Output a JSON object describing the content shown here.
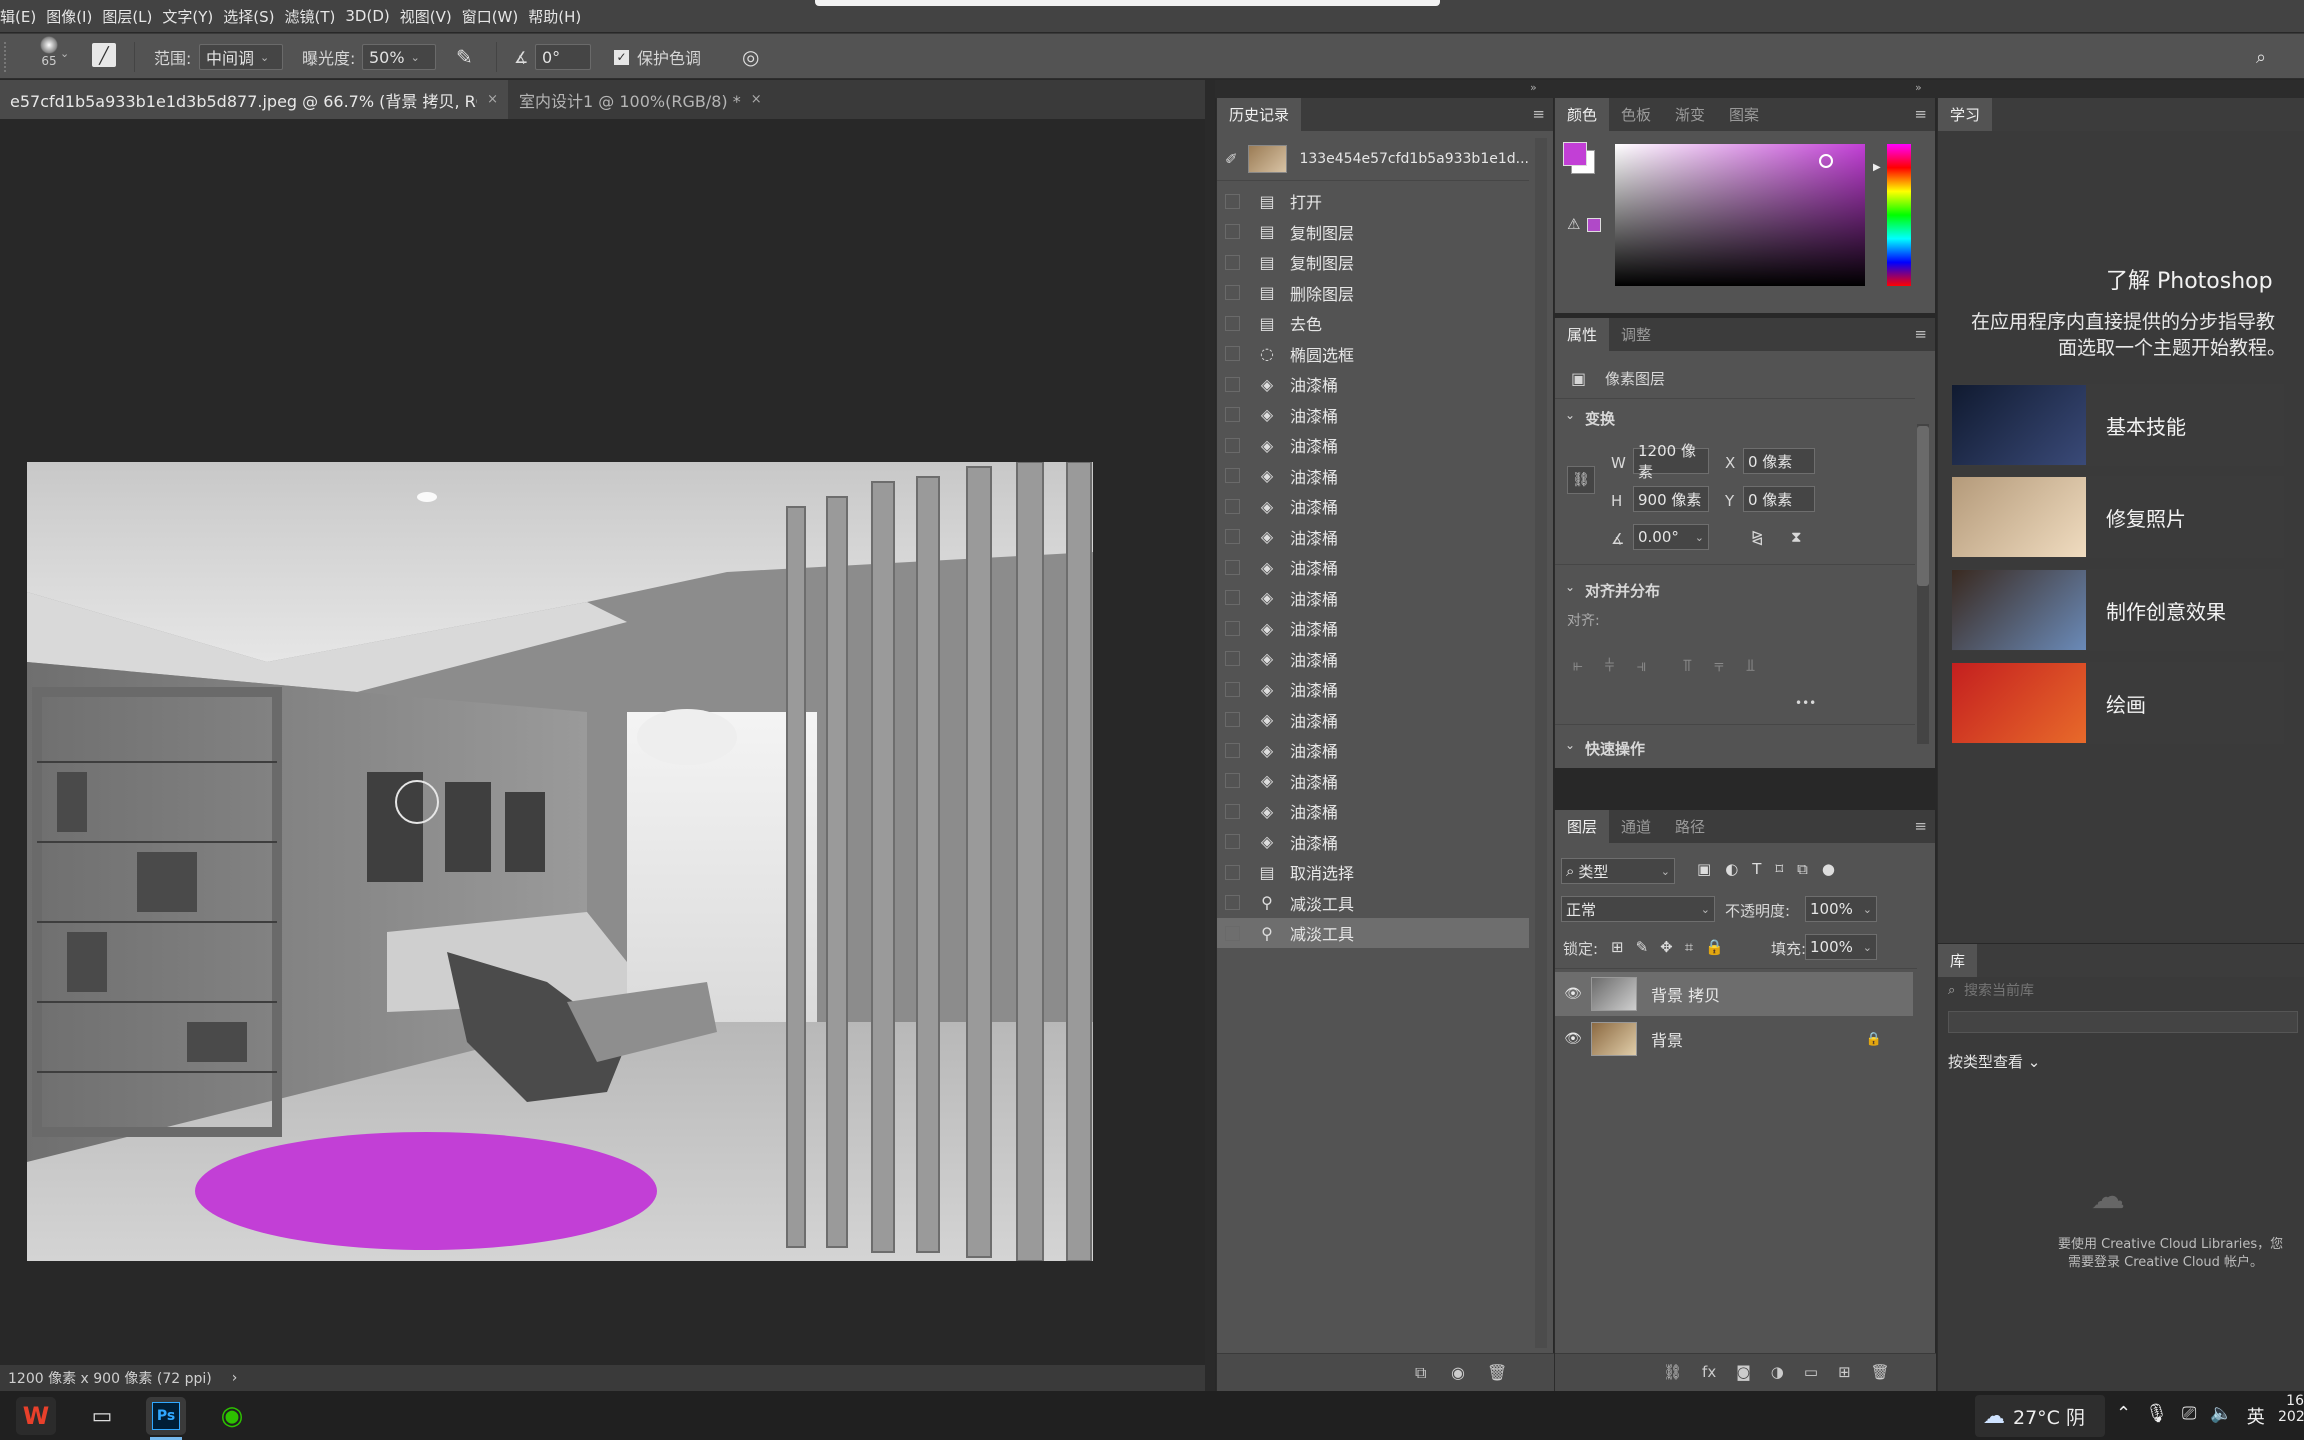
{
  "menu": [
    "辑(E)",
    "图像(I)",
    "图层(L)",
    "文字(Y)",
    "选择(S)",
    "滤镜(T)",
    "3D(D)",
    "视图(V)",
    "窗口(W)",
    "帮助(H)"
  ],
  "options": {
    "brush_size": "65",
    "range_label": "范围:",
    "range_value": "中间调",
    "exposure_label": "曝光度:",
    "exposure_value": "50%",
    "angle_value": "0°",
    "protect_tone": "保护色调"
  },
  "tabs": [
    {
      "label": "e57cfd1b5a933b1e1d3b5d877.jpeg @ 66.7% (背景 拷贝, RGB/8#) *",
      "close": "×"
    },
    {
      "label": "室内设计1 @ 100%(RGB/8) *",
      "close": "×"
    }
  ],
  "status": {
    "size": "1200 像素 x 900 像素 (72 ppi)",
    "arrow": "›"
  },
  "history": {
    "title": "历史记录",
    "snapshot": "133e454e57cfd1b5a933b1e1d...",
    "items": [
      {
        "label": "打开",
        "icon": "doc"
      },
      {
        "label": "复制图层",
        "icon": "doc"
      },
      {
        "label": "复制图层",
        "icon": "doc"
      },
      {
        "label": "删除图层",
        "icon": "doc"
      },
      {
        "label": "去色",
        "icon": "doc"
      },
      {
        "label": "椭圆选框",
        "icon": "ellipse"
      },
      {
        "label": "油漆桶",
        "icon": "bucket"
      },
      {
        "label": "油漆桶",
        "icon": "bucket"
      },
      {
        "label": "油漆桶",
        "icon": "bucket"
      },
      {
        "label": "油漆桶",
        "icon": "bucket"
      },
      {
        "label": "油漆桶",
        "icon": "bucket"
      },
      {
        "label": "油漆桶",
        "icon": "bucket"
      },
      {
        "label": "油漆桶",
        "icon": "bucket"
      },
      {
        "label": "油漆桶",
        "icon": "bucket"
      },
      {
        "label": "油漆桶",
        "icon": "bucket"
      },
      {
        "label": "油漆桶",
        "icon": "bucket"
      },
      {
        "label": "油漆桶",
        "icon": "bucket"
      },
      {
        "label": "油漆桶",
        "icon": "bucket"
      },
      {
        "label": "油漆桶",
        "icon": "bucket"
      },
      {
        "label": "油漆桶",
        "icon": "bucket"
      },
      {
        "label": "油漆桶",
        "icon": "bucket"
      },
      {
        "label": "油漆桶",
        "icon": "bucket"
      },
      {
        "label": "取消选择",
        "icon": "doc"
      },
      {
        "label": "减淡工具",
        "icon": "dodge"
      },
      {
        "label": "减淡工具",
        "icon": "dodge"
      }
    ]
  },
  "color_panel": {
    "tabs": [
      "颜色",
      "色板",
      "渐变",
      "图案"
    ],
    "foreground": "#c23fd6",
    "accent": "#c23fd6"
  },
  "properties": {
    "tabs": [
      "属性",
      "调整"
    ],
    "type": "像素图层",
    "transform": "变换",
    "w_label": "W",
    "w": "1200 像素",
    "x_label": "X",
    "x": "0 像素",
    "h_label": "H",
    "h": "900 像素",
    "y_label": "Y",
    "y": "0 像素",
    "angle": "0.00°",
    "align_section": "对齐并分布",
    "align_label": "对齐:",
    "more": "•••",
    "quick": "快速操作"
  },
  "layers": {
    "tabs": [
      "图层",
      "通道",
      "路径"
    ],
    "filter": "类型",
    "blend": "正常",
    "opacity_label": "不透明度:",
    "opacity": "100%",
    "lock_label": "锁定:",
    "fill_label": "填充:",
    "fill": "100%",
    "items": [
      {
        "name": "背景 拷贝"
      },
      {
        "name": "背景"
      }
    ]
  },
  "learn": {
    "tab": "学习",
    "title": "了解 Photoshop",
    "desc1": "在应用程序内直接提供的分步指导教",
    "desc2": "面选取一个主题开始教程。",
    "cards": [
      "基本技能",
      "修复照片",
      "制作创意效果",
      "绘画"
    ]
  },
  "library": {
    "tab": "库",
    "search_placeholder": "搜索当前库",
    "view": "按类型查看",
    "msg1": "要使用 Creative Cloud Libraries，您",
    "msg2": "需要登录 Creative Cloud 帐户。"
  },
  "taskbar": {
    "weather": "27°C 阴",
    "lang": "英",
    "time": "16",
    "date": "202"
  }
}
